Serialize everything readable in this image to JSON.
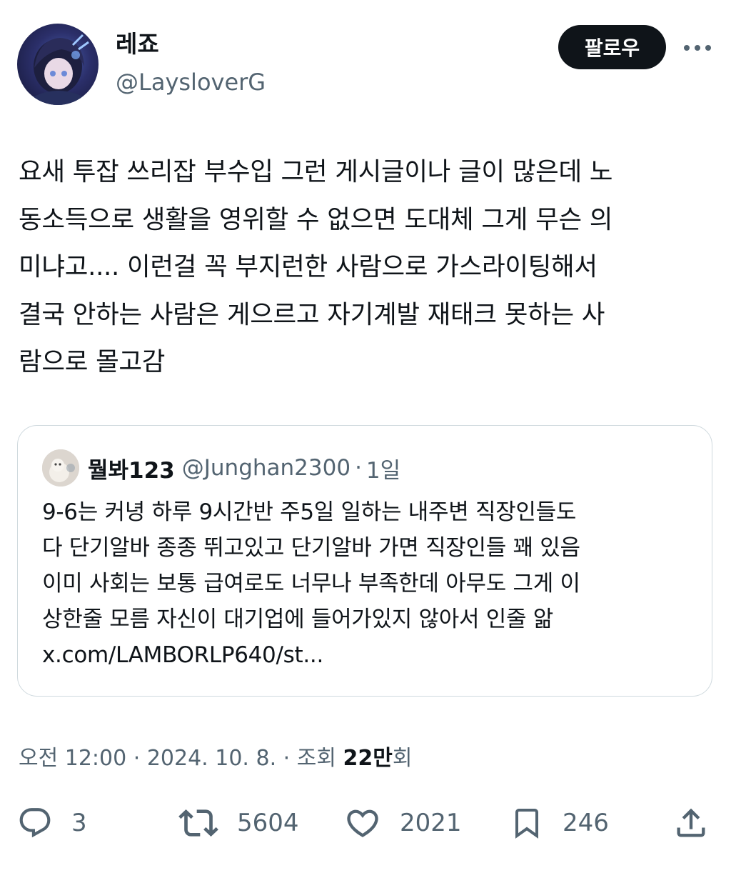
{
  "author": {
    "display_name": "레죠",
    "handle": "@LaysloverG"
  },
  "follow_button": "팔로우",
  "tweet": {
    "lines": [
      "요새 투잡 쓰리잡 부수입 그런 게시글이나 글이 많은데 노",
      "동소득으로 생활을 영위할 수 없으면 도대체 그게 무슨 의",
      "미냐고.... 이런걸 꼭 부지런한 사람으로 가스라이팅해서",
      "결국 안하는 사람은 게으르고 자기계발 재태크 못하는 사",
      "람으로 몰고감"
    ]
  },
  "quote": {
    "display_name": "뭘봐123",
    "handle": "@Junghan2300",
    "separator": "·",
    "time": "1일",
    "lines": [
      "9-6는 커녕 하루 9시간반 주5일 일하는 내주변 직장인들도",
      "다 단기알바 종종 뛰고있고 단기알바 가면 직장인들 꽤 있음",
      "이미 사회는 보통 급여로도 너무나 부족한데 아무도 그게 이",
      "상한줄 모름 자신이 대기업에 들어가있지 않아서 인줄 앎",
      "x.com/LAMBORLP640/st..."
    ]
  },
  "meta": {
    "time": "오전 12:00",
    "sep": " · ",
    "date": "2024. 10. 8.",
    "views_label": "조회 ",
    "views_count": "22만",
    "views_suffix": "회"
  },
  "actions": {
    "replies": "3",
    "retweets": "5604",
    "likes": "2021",
    "bookmarks": "246"
  },
  "icons": {
    "more": "more-horizontal-icon",
    "reply": "reply-icon",
    "retweet": "retweet-icon",
    "like": "heart-icon",
    "bookmark": "bookmark-icon",
    "share": "share-icon"
  }
}
